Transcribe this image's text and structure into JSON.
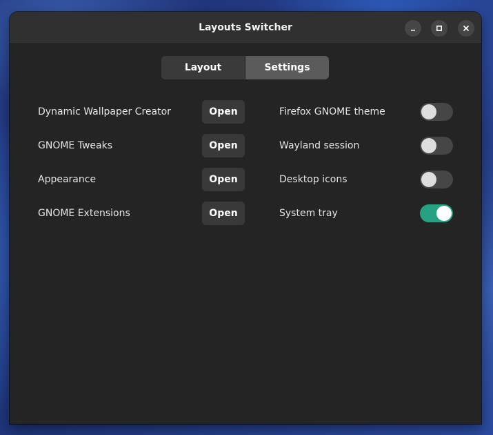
{
  "window": {
    "title": "Layouts Switcher"
  },
  "titlebar_buttons": [
    {
      "name": "minimize",
      "icon": "minimize-icon"
    },
    {
      "name": "maximize",
      "icon": "maximize-icon"
    },
    {
      "name": "close",
      "icon": "close-icon"
    }
  ],
  "tabs": [
    {
      "label": "Layout",
      "selected": false
    },
    {
      "label": "Settings",
      "selected": true
    }
  ],
  "apps": [
    {
      "label": "Dynamic Wallpaper Creator",
      "button_label": "Open"
    },
    {
      "label": "GNOME Tweaks",
      "button_label": "Open"
    },
    {
      "label": "Appearance",
      "button_label": "Open"
    },
    {
      "label": "GNOME Extensions",
      "button_label": "Open"
    }
  ],
  "toggles": [
    {
      "label": "Firefox GNOME theme",
      "on": false
    },
    {
      "label": "Wayland session",
      "on": false
    },
    {
      "label": "Desktop icons",
      "on": false
    },
    {
      "label": "System tray",
      "on": true
    }
  ],
  "colors": {
    "window_bg": "#242424",
    "titlebar_bg": "#303030",
    "accent_switch_on": "#26a182",
    "button_bg": "#393939"
  }
}
